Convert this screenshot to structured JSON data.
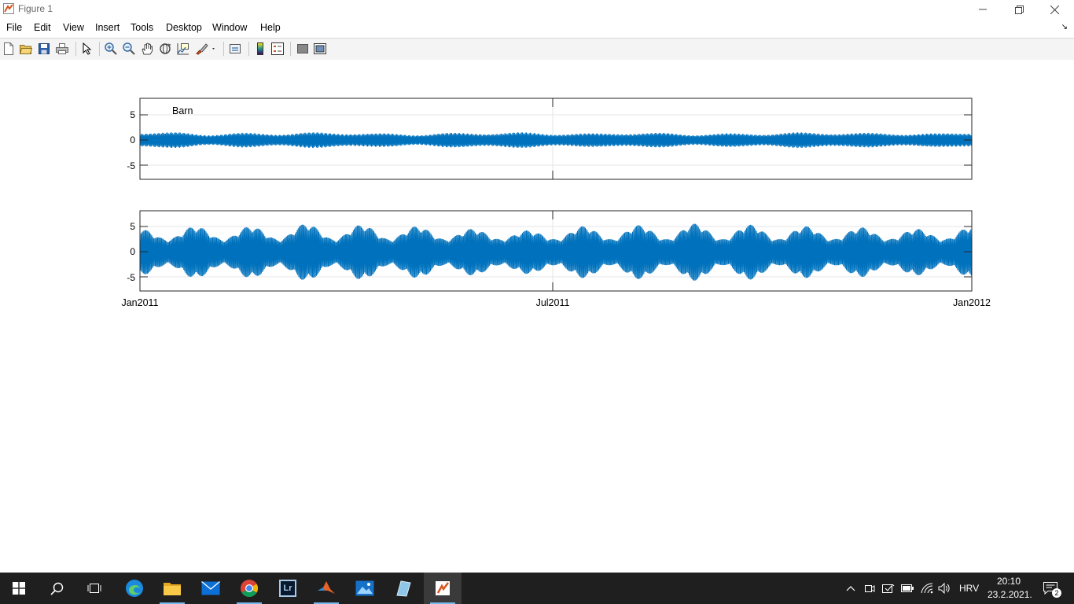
{
  "window": {
    "title": "Figure 1",
    "icon": "matlab-figure-icon",
    "controls": [
      "minimize-icon",
      "restore-icon",
      "close-icon"
    ]
  },
  "menu": {
    "items": [
      "File",
      "Edit",
      "View",
      "Insert",
      "Tools",
      "Desktop",
      "Window",
      "Help"
    ],
    "dock_icon": "dock-arrow-icon"
  },
  "toolbar": {
    "buttons": [
      "new-figure-icon",
      "open-file-icon",
      "save-icon",
      "print-icon",
      "edit-plot-pointer-icon",
      "zoom-in-icon",
      "zoom-out-icon",
      "pan-hand-icon",
      "rotate-3d-icon",
      "data-cursor-icon",
      "brush-icon",
      "link-plot-icon",
      "insert-colorbar-icon",
      "insert-legend-icon",
      "hide-plot-tools-icon",
      "show-plot-tools-icon"
    ]
  },
  "plot_color": "#0072BD",
  "chart_data": [
    {
      "type": "line",
      "title": "",
      "legend": [
        "Barn"
      ],
      "legend_placement": "top-left",
      "xlabel": "",
      "ylabel": "",
      "x_range": [
        "Jan2011",
        "Jan2012"
      ],
      "x_ticks": [
        "Jan2011",
        "Jul2011",
        "Jan2012"
      ],
      "x_tick_labels_shown": false,
      "y_ticks": [
        5,
        0,
        -5
      ],
      "ylim": [
        -7.5,
        8
      ],
      "grid": true,
      "series": [
        {
          "name": "Barn",
          "envelope": [
            1.2,
            1.5,
            0.9,
            1.4,
            1.0,
            1.5,
            1.1,
            1.3,
            0.9,
            1.4,
            1.1,
            1.5,
            1.0,
            1.3,
            1.1,
            1.4,
            0.9,
            1.3,
            1.0,
            1.5,
            1.1,
            1.4,
            1.0,
            1.3,
            1.2
          ]
        }
      ]
    },
    {
      "type": "line",
      "title": "",
      "xlabel": "",
      "ylabel": "",
      "x_range": [
        "Jan2011",
        "Jan2012"
      ],
      "x_ticks": [
        "Jan2011",
        "Jul2011",
        "Jan2012"
      ],
      "y_ticks": [
        5,
        0,
        -5
      ],
      "ylim": [
        -7.5,
        8
      ],
      "grid": true,
      "series": [
        {
          "name": "",
          "envelope": [
            4.5,
            2.5,
            5.0,
            2.5,
            5.0,
            2.5,
            5.5,
            2.5,
            5.3,
            2.5,
            5.0,
            2.5,
            4.5,
            2.5,
            4.2,
            2.5,
            5.0,
            2.5,
            5.2,
            2.5,
            5.5,
            2.5,
            5.3,
            2.5,
            5.0,
            2.5,
            4.8,
            2.5,
            4.5,
            2.5,
            5.0
          ]
        }
      ]
    }
  ],
  "taskbar": {
    "apps": [
      "windows-start-icon",
      "search-icon",
      "task-view-icon",
      "edge-icon",
      "file-explorer-icon",
      "mail-icon",
      "chrome-icon",
      "lightroom-icon",
      "matlab-icon",
      "photos-icon",
      "app-icon",
      "matlab-figure-icon"
    ],
    "lightroom_label": "Lr",
    "tray_icons": [
      "chevron-up-icon",
      "meet-now-icon",
      "security-icon",
      "battery-icon",
      "wifi-icon",
      "volume-icon"
    ],
    "language": "HRV",
    "time": "20:10",
    "date": "23.2.2021.",
    "notification_count": "2"
  }
}
